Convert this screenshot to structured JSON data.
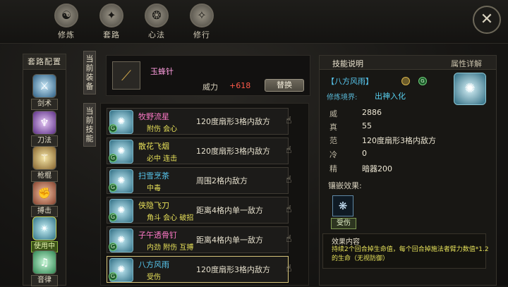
{
  "top_nav": [
    {
      "label": "修炼",
      "icon": "training-icon"
    },
    {
      "label": "套路",
      "icon": "routine-icon"
    },
    {
      "label": "心法",
      "icon": "mind-method-icon"
    },
    {
      "label": "修行",
      "icon": "practice-icon"
    }
  ],
  "close_icon": "close-icon",
  "sidebar": {
    "header": "套路配置",
    "items": [
      {
        "label": "剑术",
        "icon": "sword-art-icon"
      },
      {
        "label": "刀法",
        "icon": "blade-art-icon"
      },
      {
        "label": "枪棍",
        "icon": "spear-staff-icon"
      },
      {
        "label": "搏击",
        "icon": "combat-icon"
      },
      {
        "label": "使用中",
        "icon": "hidden-weapon-icon",
        "active": true
      },
      {
        "label": "音律",
        "icon": "music-icon"
      }
    ]
  },
  "current_equip": {
    "tag": "当前装备",
    "name": "玉蜂针",
    "power_label": "威力",
    "power_value": "+618",
    "swap_label": "替换",
    "icon": "needle-icon"
  },
  "current_skills": {
    "tag": "当前技能",
    "rows": [
      {
        "name": "牧野流星",
        "name_color": "#ff7ac8",
        "sub": "附伤  会心",
        "desc": "120度扇形3格内敌方",
        "badge": "G"
      },
      {
        "name": "散花飞烟",
        "name_color": "#e7e059",
        "sub": "必中  连击",
        "desc": "120度扇形3格内敌方",
        "badge": "G"
      },
      {
        "name": "扫雪烹茶",
        "name_color": "#58c8f0",
        "sub": "中毒",
        "desc": "周围2格内敌方",
        "badge": "G"
      },
      {
        "name": "侠隐飞刀",
        "name_color": "#e7e059",
        "sub": "角斗  会心  破招",
        "desc": "距离4格内单一敌方",
        "badge": "G"
      },
      {
        "name": "子午透骨钉",
        "name_color": "#ff7ac8",
        "sub": "内劲  附伤  互搏",
        "desc": "距离4格内单一敌方",
        "badge": "G"
      },
      {
        "name": "八方风雨",
        "name_color": "#58c8f0",
        "sub": "受伤",
        "desc": "120度扇形3格内敌方",
        "badge": "G",
        "selected": true
      }
    ]
  },
  "detail": {
    "tab_skill": "技能说明",
    "tab_attr": "属性详解",
    "skill_title": "【八方风雨】",
    "realm_label": "修炼境界:",
    "realm_value": "出神入化",
    "stats": [
      {
        "k": "威",
        "v": "2886"
      },
      {
        "k": "真",
        "v": "55"
      },
      {
        "k": "范",
        "v": "120度扇形3格内敌方"
      },
      {
        "k": "冷",
        "v": "0"
      },
      {
        "k": "精",
        "v": "暗器200"
      }
    ],
    "inlay_label": "镶嵌效果:",
    "gem_label": "受伤",
    "effect_header": "效果内容",
    "effect_text": "持续2个回合掉生命值，每个回合掉施法者臂力数值*1.2的生命（无视防御）"
  }
}
